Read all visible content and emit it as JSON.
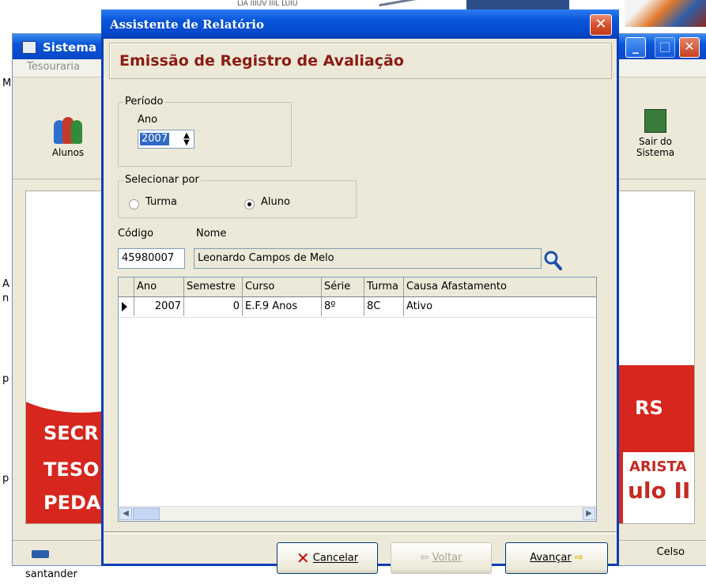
{
  "background_window": {
    "title": "Sistema",
    "menu": [
      "Tesouraria"
    ],
    "toolbar": {
      "alunos_label": "Alunos",
      "sair_label_1": "Sair do",
      "sair_label_2": "Sistema"
    },
    "banner_lines": [
      "SECR",
      "TESO",
      "PEDA"
    ],
    "banner_right": [
      "RS",
      "ARISTA",
      "ulo II"
    ],
    "status_user": "Celso",
    "left_marks": [
      "A",
      "n",
      "p",
      "p"
    ],
    "top_text": "LIA IIIUV IIIL LUIU"
  },
  "desktop": {
    "icon_label": "santander"
  },
  "dialog": {
    "title": "Assistente de Relatório",
    "header": "Emissão de Registro de Avaliação",
    "periodo": {
      "legend": "Período",
      "ano_label": "Ano",
      "ano_value": "2007"
    },
    "selecionar": {
      "legend": "Selecionar por",
      "options": [
        {
          "label": "Turma",
          "selected": false
        },
        {
          "label": "Aluno",
          "selected": true
        }
      ]
    },
    "codigo_label": "Código",
    "nome_label": "Nome",
    "codigo_value": "45980007",
    "nome_value": "Leonardo Campos de Melo",
    "grid": {
      "columns": [
        "Ano",
        "Semestre",
        "Curso",
        "Série",
        "Turma",
        "Causa Afastamento"
      ],
      "rows": [
        [
          "2007",
          "0",
          "E.F.9 Anos",
          "8º",
          "8C",
          "Ativo"
        ]
      ]
    },
    "buttons": {
      "cancelar": "Cancelar",
      "voltar": "Voltar",
      "avancar": "Avançar"
    }
  },
  "colors": {
    "title_blue": "#0a57db",
    "header_red": "#8b1c14",
    "banner_red": "#d7261e",
    "dialog_bg": "#ece9d8"
  }
}
